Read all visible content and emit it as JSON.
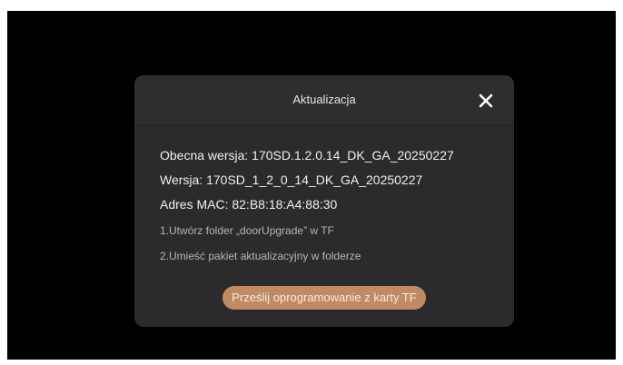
{
  "dialog": {
    "title": "Aktualizacja",
    "close_icon": "close-icon",
    "current_version": "Obecna wersja:  170SD.1.2.0.14_DK_GA_20250227",
    "version": "Wersja:  170SD_1_2_0_14_DK_GA_20250227",
    "mac_address": "Adres MAC:  82:B8:18:A4:88:30",
    "instructions": [
      "1.Utwórz folder „doorUpgrade” w TF",
      "2.Umieść pakiet aktualizacyjny w folderze"
    ],
    "upload_button_label": "Prześlij oprogramowanie z karty TF"
  },
  "colors": {
    "background": "#000000",
    "dialog": "#2b2b2d",
    "accent": "#c08a62"
  }
}
